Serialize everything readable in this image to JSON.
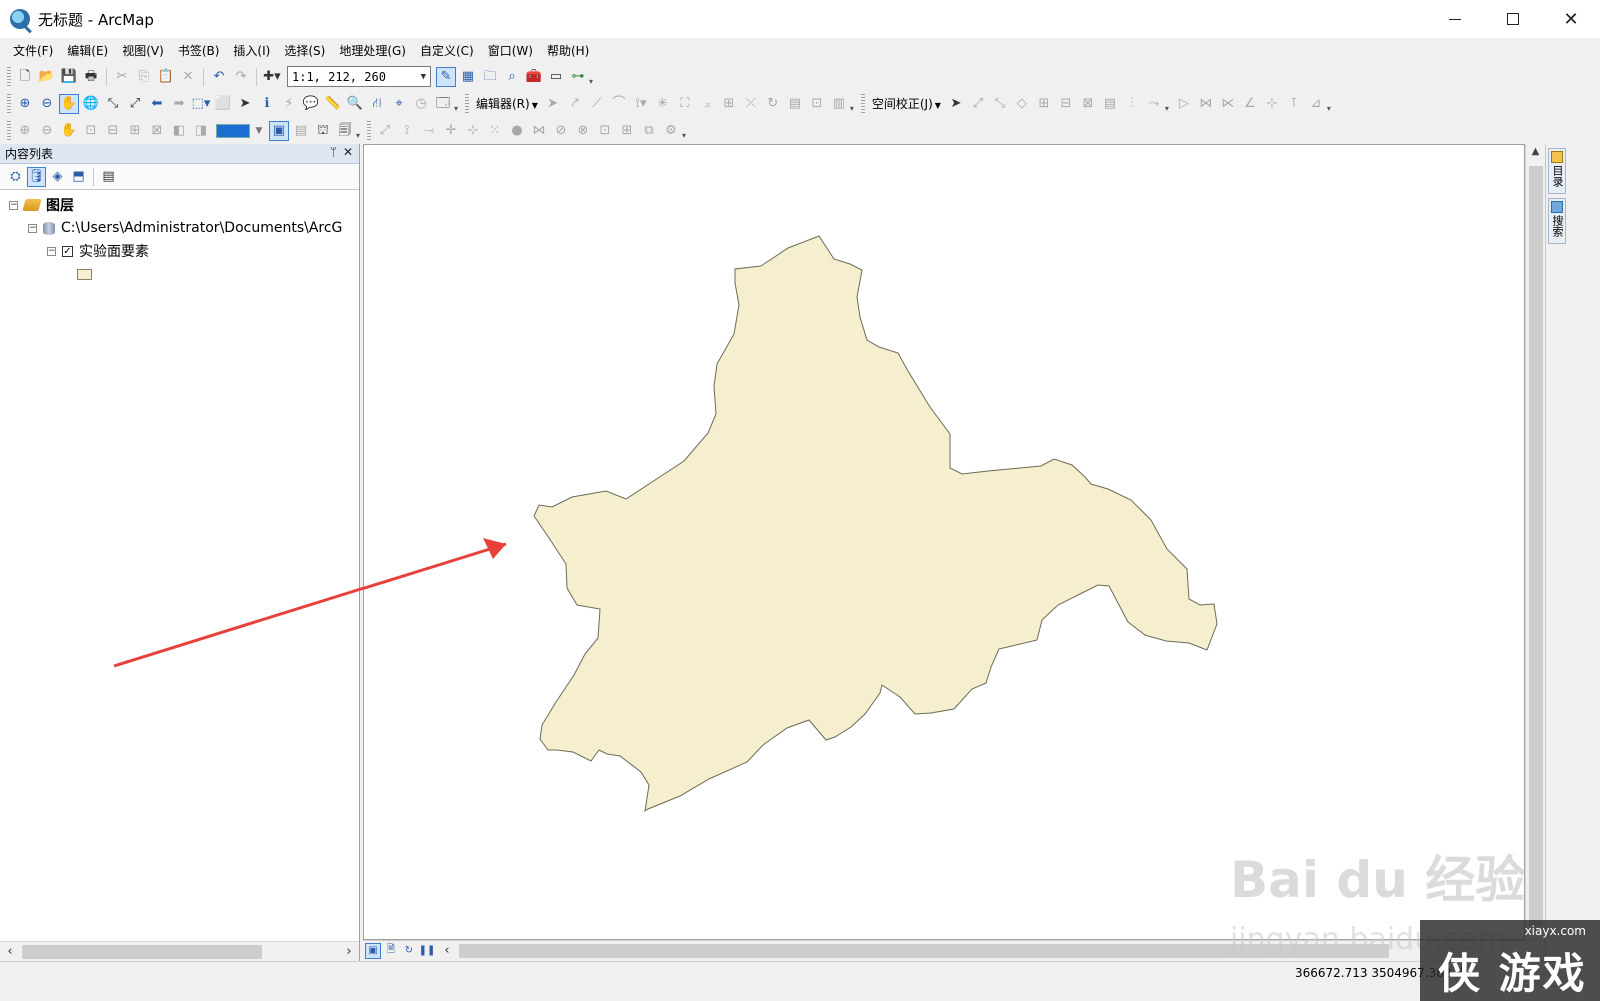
{
  "window": {
    "title": "无标题 - ArcMap",
    "minimize": "—",
    "close": "✕"
  },
  "menubar": {
    "items": [
      "文件(F)",
      "编辑(E)",
      "视图(V)",
      "书签(B)",
      "插入(I)",
      "选择(S)",
      "地理处理(G)",
      "自定义(C)",
      "窗口(W)",
      "帮助(H)"
    ]
  },
  "toolbar": {
    "scale": "1:1, 212, 260",
    "editor_label": "编辑器(R)",
    "spatial_adjust_label": "空间校正(J)",
    "accent_color": "#1c6fd0"
  },
  "toc": {
    "title": "内容列表",
    "pin": "ᛘ",
    "close": "✕",
    "layers_label": "图层",
    "datasource_path": "C:\\Users\\Administrator\\Documents\\ArcG",
    "layer_name": "实验面要素",
    "layer_checked": "✓",
    "legend_fill": "#f5efd0"
  },
  "map": {
    "polygon_fill": "#f5efd0",
    "polygon_stroke": "#6b6b55",
    "arrow_color": "#e8403a"
  },
  "right_dock": {
    "tabs": [
      "目录",
      "搜索"
    ]
  },
  "statusbar": {
    "coordinates": "366672.713  3504967.382 米"
  },
  "watermarks": {
    "baidu": "Bai du 经验",
    "jingyan": "jingyan.baidu.com",
    "site": "xiayx.com",
    "logo_text": "侠 游戏"
  }
}
